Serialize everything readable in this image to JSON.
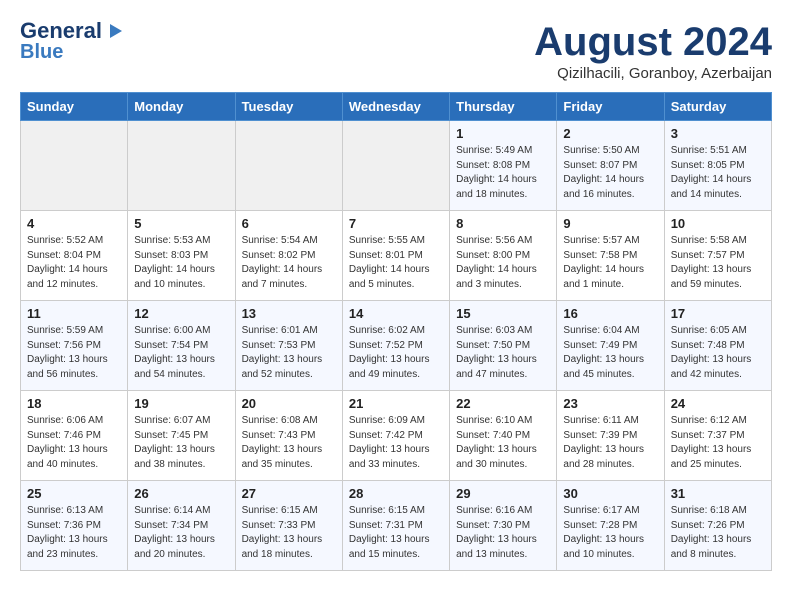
{
  "header": {
    "logo_line1": "General",
    "logo_line2": "Blue",
    "month": "August 2024",
    "location": "Qizilhacili, Goranboy, Azerbaijan"
  },
  "weekdays": [
    "Sunday",
    "Monday",
    "Tuesday",
    "Wednesday",
    "Thursday",
    "Friday",
    "Saturday"
  ],
  "weeks": [
    [
      {
        "day": "",
        "content": ""
      },
      {
        "day": "",
        "content": ""
      },
      {
        "day": "",
        "content": ""
      },
      {
        "day": "",
        "content": ""
      },
      {
        "day": "1",
        "content": "Sunrise: 5:49 AM\nSunset: 8:08 PM\nDaylight: 14 hours\nand 18 minutes."
      },
      {
        "day": "2",
        "content": "Sunrise: 5:50 AM\nSunset: 8:07 PM\nDaylight: 14 hours\nand 16 minutes."
      },
      {
        "day": "3",
        "content": "Sunrise: 5:51 AM\nSunset: 8:05 PM\nDaylight: 14 hours\nand 14 minutes."
      }
    ],
    [
      {
        "day": "4",
        "content": "Sunrise: 5:52 AM\nSunset: 8:04 PM\nDaylight: 14 hours\nand 12 minutes."
      },
      {
        "day": "5",
        "content": "Sunrise: 5:53 AM\nSunset: 8:03 PM\nDaylight: 14 hours\nand 10 minutes."
      },
      {
        "day": "6",
        "content": "Sunrise: 5:54 AM\nSunset: 8:02 PM\nDaylight: 14 hours\nand 7 minutes."
      },
      {
        "day": "7",
        "content": "Sunrise: 5:55 AM\nSunset: 8:01 PM\nDaylight: 14 hours\nand 5 minutes."
      },
      {
        "day": "8",
        "content": "Sunrise: 5:56 AM\nSunset: 8:00 PM\nDaylight: 14 hours\nand 3 minutes."
      },
      {
        "day": "9",
        "content": "Sunrise: 5:57 AM\nSunset: 7:58 PM\nDaylight: 14 hours\nand 1 minute."
      },
      {
        "day": "10",
        "content": "Sunrise: 5:58 AM\nSunset: 7:57 PM\nDaylight: 13 hours\nand 59 minutes."
      }
    ],
    [
      {
        "day": "11",
        "content": "Sunrise: 5:59 AM\nSunset: 7:56 PM\nDaylight: 13 hours\nand 56 minutes."
      },
      {
        "day": "12",
        "content": "Sunrise: 6:00 AM\nSunset: 7:54 PM\nDaylight: 13 hours\nand 54 minutes."
      },
      {
        "day": "13",
        "content": "Sunrise: 6:01 AM\nSunset: 7:53 PM\nDaylight: 13 hours\nand 52 minutes."
      },
      {
        "day": "14",
        "content": "Sunrise: 6:02 AM\nSunset: 7:52 PM\nDaylight: 13 hours\nand 49 minutes."
      },
      {
        "day": "15",
        "content": "Sunrise: 6:03 AM\nSunset: 7:50 PM\nDaylight: 13 hours\nand 47 minutes."
      },
      {
        "day": "16",
        "content": "Sunrise: 6:04 AM\nSunset: 7:49 PM\nDaylight: 13 hours\nand 45 minutes."
      },
      {
        "day": "17",
        "content": "Sunrise: 6:05 AM\nSunset: 7:48 PM\nDaylight: 13 hours\nand 42 minutes."
      }
    ],
    [
      {
        "day": "18",
        "content": "Sunrise: 6:06 AM\nSunset: 7:46 PM\nDaylight: 13 hours\nand 40 minutes."
      },
      {
        "day": "19",
        "content": "Sunrise: 6:07 AM\nSunset: 7:45 PM\nDaylight: 13 hours\nand 38 minutes."
      },
      {
        "day": "20",
        "content": "Sunrise: 6:08 AM\nSunset: 7:43 PM\nDaylight: 13 hours\nand 35 minutes."
      },
      {
        "day": "21",
        "content": "Sunrise: 6:09 AM\nSunset: 7:42 PM\nDaylight: 13 hours\nand 33 minutes."
      },
      {
        "day": "22",
        "content": "Sunrise: 6:10 AM\nSunset: 7:40 PM\nDaylight: 13 hours\nand 30 minutes."
      },
      {
        "day": "23",
        "content": "Sunrise: 6:11 AM\nSunset: 7:39 PM\nDaylight: 13 hours\nand 28 minutes."
      },
      {
        "day": "24",
        "content": "Sunrise: 6:12 AM\nSunset: 7:37 PM\nDaylight: 13 hours\nand 25 minutes."
      }
    ],
    [
      {
        "day": "25",
        "content": "Sunrise: 6:13 AM\nSunset: 7:36 PM\nDaylight: 13 hours\nand 23 minutes."
      },
      {
        "day": "26",
        "content": "Sunrise: 6:14 AM\nSunset: 7:34 PM\nDaylight: 13 hours\nand 20 minutes."
      },
      {
        "day": "27",
        "content": "Sunrise: 6:15 AM\nSunset: 7:33 PM\nDaylight: 13 hours\nand 18 minutes."
      },
      {
        "day": "28",
        "content": "Sunrise: 6:15 AM\nSunset: 7:31 PM\nDaylight: 13 hours\nand 15 minutes."
      },
      {
        "day": "29",
        "content": "Sunrise: 6:16 AM\nSunset: 7:30 PM\nDaylight: 13 hours\nand 13 minutes."
      },
      {
        "day": "30",
        "content": "Sunrise: 6:17 AM\nSunset: 7:28 PM\nDaylight: 13 hours\nand 10 minutes."
      },
      {
        "day": "31",
        "content": "Sunrise: 6:18 AM\nSunset: 7:26 PM\nDaylight: 13 hours\nand 8 minutes."
      }
    ]
  ]
}
